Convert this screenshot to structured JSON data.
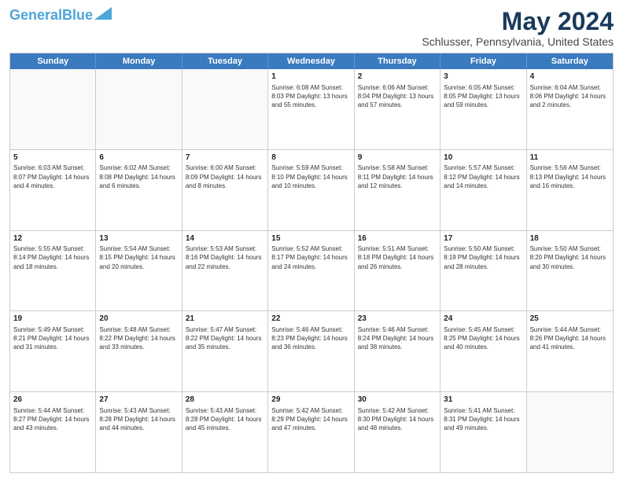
{
  "header": {
    "logo_line1": "General",
    "logo_line2": "Blue",
    "month_title": "May 2024",
    "location": "Schlusser, Pennsylvania, United States"
  },
  "weekdays": [
    "Sunday",
    "Monday",
    "Tuesday",
    "Wednesday",
    "Thursday",
    "Friday",
    "Saturday"
  ],
  "weeks": [
    [
      {
        "day": "",
        "info": ""
      },
      {
        "day": "",
        "info": ""
      },
      {
        "day": "",
        "info": ""
      },
      {
        "day": "1",
        "info": "Sunrise: 6:08 AM\nSunset: 8:03 PM\nDaylight: 13 hours\nand 55 minutes."
      },
      {
        "day": "2",
        "info": "Sunrise: 6:06 AM\nSunset: 8:04 PM\nDaylight: 13 hours\nand 57 minutes."
      },
      {
        "day": "3",
        "info": "Sunrise: 6:05 AM\nSunset: 8:05 PM\nDaylight: 13 hours\nand 59 minutes."
      },
      {
        "day": "4",
        "info": "Sunrise: 6:04 AM\nSunset: 8:06 PM\nDaylight: 14 hours\nand 2 minutes."
      }
    ],
    [
      {
        "day": "5",
        "info": "Sunrise: 6:03 AM\nSunset: 8:07 PM\nDaylight: 14 hours\nand 4 minutes."
      },
      {
        "day": "6",
        "info": "Sunrise: 6:02 AM\nSunset: 8:08 PM\nDaylight: 14 hours\nand 6 minutes."
      },
      {
        "day": "7",
        "info": "Sunrise: 6:00 AM\nSunset: 8:09 PM\nDaylight: 14 hours\nand 8 minutes."
      },
      {
        "day": "8",
        "info": "Sunrise: 5:59 AM\nSunset: 8:10 PM\nDaylight: 14 hours\nand 10 minutes."
      },
      {
        "day": "9",
        "info": "Sunrise: 5:58 AM\nSunset: 8:11 PM\nDaylight: 14 hours\nand 12 minutes."
      },
      {
        "day": "10",
        "info": "Sunrise: 5:57 AM\nSunset: 8:12 PM\nDaylight: 14 hours\nand 14 minutes."
      },
      {
        "day": "11",
        "info": "Sunrise: 5:56 AM\nSunset: 8:13 PM\nDaylight: 14 hours\nand 16 minutes."
      }
    ],
    [
      {
        "day": "12",
        "info": "Sunrise: 5:55 AM\nSunset: 8:14 PM\nDaylight: 14 hours\nand 18 minutes."
      },
      {
        "day": "13",
        "info": "Sunrise: 5:54 AM\nSunset: 8:15 PM\nDaylight: 14 hours\nand 20 minutes."
      },
      {
        "day": "14",
        "info": "Sunrise: 5:53 AM\nSunset: 8:16 PM\nDaylight: 14 hours\nand 22 minutes."
      },
      {
        "day": "15",
        "info": "Sunrise: 5:52 AM\nSunset: 8:17 PM\nDaylight: 14 hours\nand 24 minutes."
      },
      {
        "day": "16",
        "info": "Sunrise: 5:51 AM\nSunset: 8:18 PM\nDaylight: 14 hours\nand 26 minutes."
      },
      {
        "day": "17",
        "info": "Sunrise: 5:50 AM\nSunset: 8:19 PM\nDaylight: 14 hours\nand 28 minutes."
      },
      {
        "day": "18",
        "info": "Sunrise: 5:50 AM\nSunset: 8:20 PM\nDaylight: 14 hours\nand 30 minutes."
      }
    ],
    [
      {
        "day": "19",
        "info": "Sunrise: 5:49 AM\nSunset: 8:21 PM\nDaylight: 14 hours\nand 31 minutes."
      },
      {
        "day": "20",
        "info": "Sunrise: 5:48 AM\nSunset: 8:22 PM\nDaylight: 14 hours\nand 33 minutes."
      },
      {
        "day": "21",
        "info": "Sunrise: 5:47 AM\nSunset: 8:22 PM\nDaylight: 14 hours\nand 35 minutes."
      },
      {
        "day": "22",
        "info": "Sunrise: 5:46 AM\nSunset: 8:23 PM\nDaylight: 14 hours\nand 36 minutes."
      },
      {
        "day": "23",
        "info": "Sunrise: 5:46 AM\nSunset: 8:24 PM\nDaylight: 14 hours\nand 38 minutes."
      },
      {
        "day": "24",
        "info": "Sunrise: 5:45 AM\nSunset: 8:25 PM\nDaylight: 14 hours\nand 40 minutes."
      },
      {
        "day": "25",
        "info": "Sunrise: 5:44 AM\nSunset: 8:26 PM\nDaylight: 14 hours\nand 41 minutes."
      }
    ],
    [
      {
        "day": "26",
        "info": "Sunrise: 5:44 AM\nSunset: 8:27 PM\nDaylight: 14 hours\nand 43 minutes."
      },
      {
        "day": "27",
        "info": "Sunrise: 5:43 AM\nSunset: 8:28 PM\nDaylight: 14 hours\nand 44 minutes."
      },
      {
        "day": "28",
        "info": "Sunrise: 5:43 AM\nSunset: 8:28 PM\nDaylight: 14 hours\nand 45 minutes."
      },
      {
        "day": "29",
        "info": "Sunrise: 5:42 AM\nSunset: 8:29 PM\nDaylight: 14 hours\nand 47 minutes."
      },
      {
        "day": "30",
        "info": "Sunrise: 5:42 AM\nSunset: 8:30 PM\nDaylight: 14 hours\nand 48 minutes."
      },
      {
        "day": "31",
        "info": "Sunrise: 5:41 AM\nSunset: 8:31 PM\nDaylight: 14 hours\nand 49 minutes."
      },
      {
        "day": "",
        "info": ""
      }
    ]
  ]
}
